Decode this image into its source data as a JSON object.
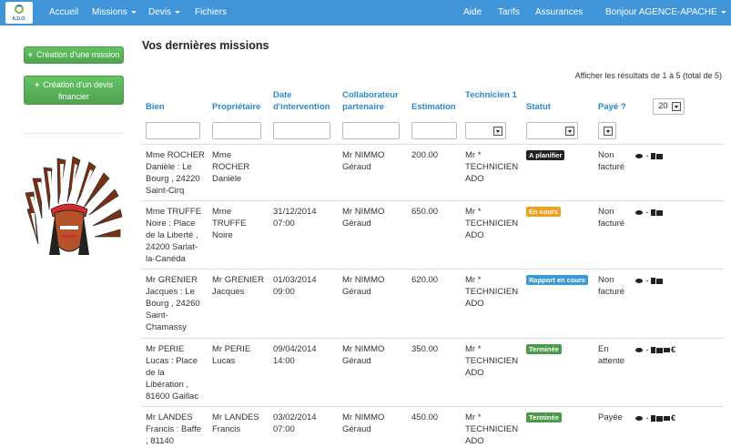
{
  "nav": {
    "logo_text": "A.D.O.",
    "items": [
      "Accueil",
      "Missions",
      "Devis",
      "Fichiers"
    ],
    "right_items": [
      "Aide",
      "Tarifs",
      "Assurances",
      "Bonjour AGENCE-APACHE"
    ]
  },
  "sidebar": {
    "btn_mission": "Création d'une mission",
    "btn_devis": "Création d'un devis financier"
  },
  "main": {
    "title": "Vos dernières missions",
    "results": "Afficher les résultats de 1 à 5 (total de 5)",
    "per_page": "20"
  },
  "table": {
    "headers": [
      "Bien",
      "Propriétaire",
      "Date d'intervention",
      "Collaborateur partenaire",
      "Estimation",
      "Technicien 1",
      "Statut",
      "Payé ?"
    ],
    "rows": [
      {
        "bien": "Mme ROCHER Danièle : Le Bourg , 24220 Saint-Cirq",
        "proprietaire": "Mme ROCHER Danièle",
        "date": "",
        "collab": "Mr NIMMO Géraud",
        "estimation": "200.00",
        "technicien": "Mr * TECHNICIEN ADO",
        "statut": "A planifier",
        "statut_color": "#222222",
        "paye": "Non facturé",
        "actions": [
          "eye-icon",
          "doc-icon",
          "print-icon"
        ]
      },
      {
        "bien": "Mme TRUFFE Noire : Place de la Liberté , 24200 Sarlat-la-Canéda",
        "proprietaire": "Mme TRUFFE Noire",
        "date": "31/12/2014 07:00",
        "collab": "Mr NIMMO Géraud",
        "estimation": "650.00",
        "technicien": "Mr * TECHNICIEN ADO",
        "statut": "En cours",
        "statut_color": "#f0a020",
        "paye": "Non facturé",
        "actions": [
          "eye-icon",
          "doc-icon",
          "print-icon"
        ]
      },
      {
        "bien": "Mr GRENIER Jacques : Le Bourg , 24260 Saint-Chamassy",
        "proprietaire": "Mr GRENIER Jacques",
        "date": "01/03/2014 09:00",
        "collab": "Mr NIMMO Géraud",
        "estimation": "620.00",
        "technicien": "Mr * TECHNICIEN ADO",
        "statut": "Rapport en cours",
        "statut_color": "#3a9ad9",
        "paye": "Non facturé",
        "actions": [
          "eye-icon",
          "doc-icon",
          "print-icon"
        ]
      },
      {
        "bien": "Mr PERIE Lucas : Place de la Libération , 81600 Gaillac",
        "proprietaire": "Mr PERIE Lucas",
        "date": "09/04/2014 14:00",
        "collab": "Mr NIMMO Géraud",
        "estimation": "350.00",
        "technicien": "Mr * TECHNICIEN ADO",
        "statut": "Terminée",
        "statut_color": "#4a9a4a",
        "paye": "En attente",
        "actions": [
          "eye-icon",
          "doc-icon",
          "print-icon",
          "briefcase-icon",
          "euro-icon"
        ]
      },
      {
        "bien": "Mr LANDES Francis : Baffe , 81140",
        "proprietaire": "Mr LANDES Francis",
        "date": "03/02/2014 07:00",
        "collab": "Mr NIMMO Géraud",
        "estimation": "450.00",
        "technicien": "Mr * TECHNICIEN ADO",
        "statut": "Terminée",
        "statut_color": "#4a9a4a",
        "paye": "Payée",
        "actions": [
          "eye-icon",
          "doc-icon",
          "print-icon",
          "briefcase-icon",
          "euro-icon"
        ]
      }
    ]
  },
  "colors": {
    "navbar": "#3f95d8",
    "header_link": "#2a88d0",
    "button_green": "#51a351"
  }
}
